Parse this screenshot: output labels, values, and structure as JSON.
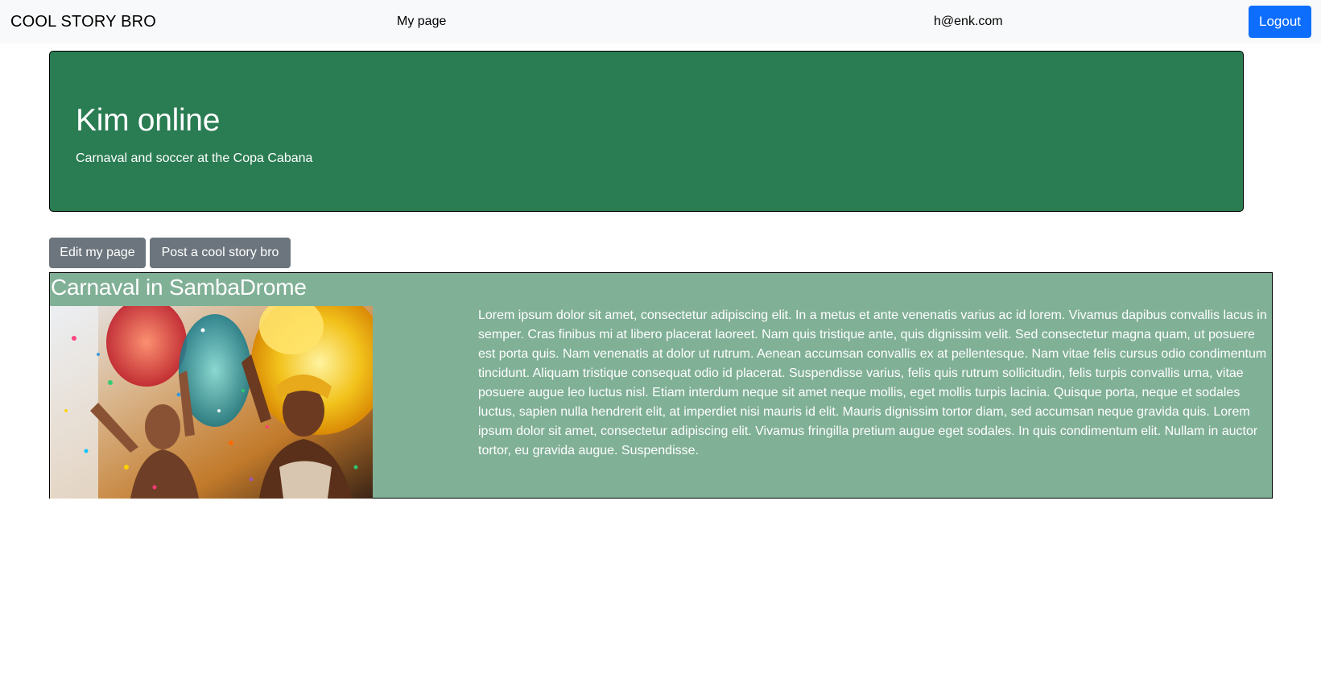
{
  "navbar": {
    "brand": "COOL STORY BRO",
    "my_page_link": "My page",
    "user_email": "h@enk.com",
    "logout_label": "Logout"
  },
  "jumbotron": {
    "title": "Kim online",
    "subtitle": "Carnaval and soccer at the Copa Cabana",
    "background_color": "#2a7c52"
  },
  "actions": {
    "edit_label": "Edit my page",
    "post_label": "Post a cool story bro"
  },
  "story": {
    "title": "Carnaval in SambaDrome",
    "image_subject": "carnival-dancers-photo",
    "text": "Lorem ipsum dolor sit amet, consectetur adipiscing elit. In a metus et ante venenatis varius ac id lorem. Vivamus dapibus convallis lacus in semper. Cras finibus mi at libero placerat laoreet. Nam quis tristique ante, quis dignissim velit. Sed consectetur magna quam, ut posuere est porta quis. Nam venenatis at dolor ut rutrum. Aenean accumsan convallis ex at pellentesque. Nam vitae felis cursus odio condimentum tincidunt. Aliquam tristique consequat odio id placerat. Suspendisse varius, felis quis rutrum sollicitudin, felis turpis convallis urna, vitae posuere augue leo luctus nisl. Etiam interdum neque sit amet neque mollis, eget mollis turpis lacinia. Quisque porta, neque et sodales luctus, sapien nulla hendrerit elit, at imperdiet nisi mauris id elit. Mauris dignissim tortor diam, sed accumsan neque gravida quis. Lorem ipsum dolor sit amet, consectetur adipiscing elit. Vivamus fringilla pretium augue eget sodales. In quis condimentum elit. Nullam in auctor tortor, eu gravida augue. Suspendisse.",
    "background_color": "#80b096"
  },
  "colors": {
    "navbar_bg": "#f8f9fa",
    "primary": "#0d6efd",
    "secondary": "#6c757d"
  }
}
